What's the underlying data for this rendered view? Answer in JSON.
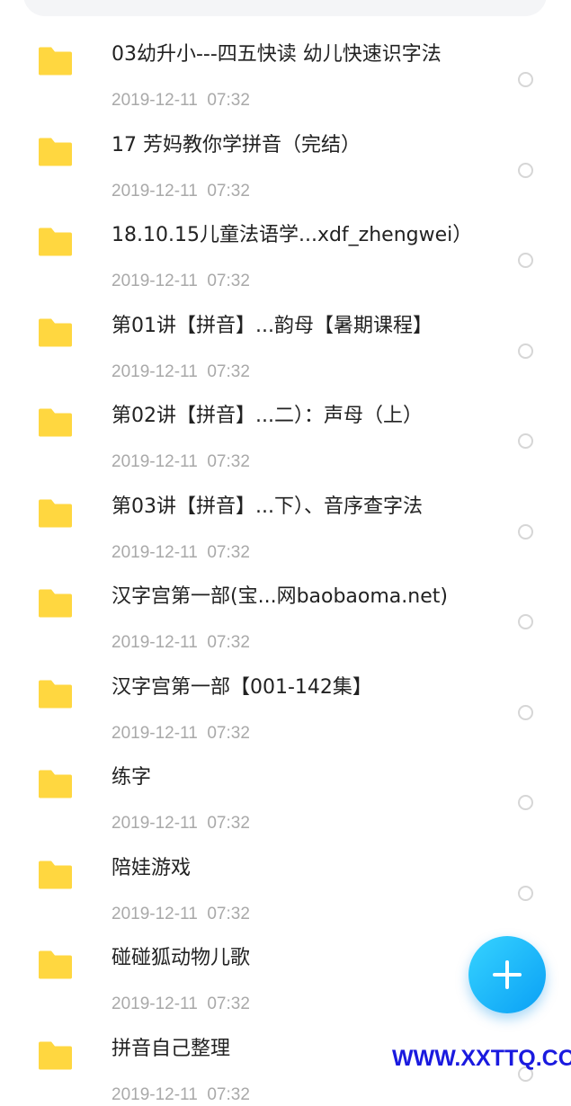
{
  "files": [
    {
      "name": "03幼升小---四五快读 幼儿快速识字法",
      "date": "2019-12-11  07:32",
      "icon": "folder-icon"
    },
    {
      "name": "17 芳妈教你学拼音（完结）",
      "date": "2019-12-11  07:32",
      "icon": "folder-icon"
    },
    {
      "name": "18.10.15儿童法语学...xdf_zhengwei）",
      "date": "2019-12-11  07:32",
      "icon": "folder-icon"
    },
    {
      "name": "第01讲【拼音】...韵母【暑期课程】",
      "date": "2019-12-11  07:32",
      "icon": "folder-icon"
    },
    {
      "name": "第02讲【拼音】...二）：声母（上）",
      "date": "2019-12-11  07:32",
      "icon": "folder-icon"
    },
    {
      "name": "第03讲【拼音】...下）、音序查字法",
      "date": "2019-12-11  07:32",
      "icon": "folder-icon"
    },
    {
      "name": "汉字宫第一部(宝...网baobaoma.net)",
      "date": "2019-12-11  07:32",
      "icon": "folder-icon"
    },
    {
      "name": "汉字宫第一部【001-142集】",
      "date": "2019-12-11  07:32",
      "icon": "folder-icon"
    },
    {
      "name": "练字",
      "date": "2019-12-11  07:32",
      "icon": "folder-icon"
    },
    {
      "name": "陪娃游戏",
      "date": "2019-12-11  07:32",
      "icon": "folder-icon"
    },
    {
      "name": "碰碰狐动物儿歌",
      "date": "2019-12-11  07:32",
      "icon": "folder-icon"
    },
    {
      "name": "拼音自己整理",
      "date": "2019-12-11  07:32",
      "icon": "folder-icon"
    }
  ],
  "fab": {
    "icon": "plus-icon"
  },
  "watermark": "WWW.XXTTQ.COM",
  "colors": {
    "folder": "#ffd740",
    "accent": "#0aa0f5",
    "date_text": "#a9a9a9",
    "watermark": "#1a1adf"
  }
}
